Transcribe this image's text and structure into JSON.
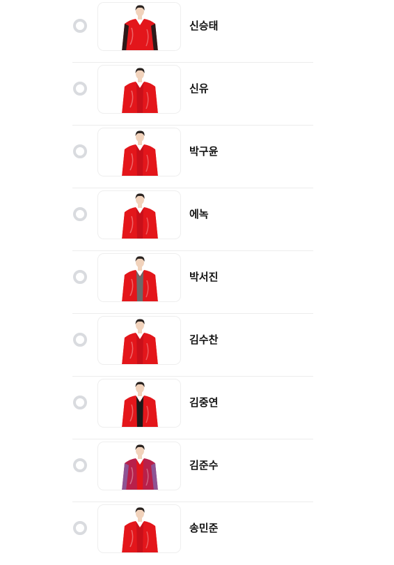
{
  "candidates": [
    {
      "name": "신승태",
      "outfit_color": "#e3161b",
      "accent": "#1a1a1a",
      "inner": "#e3161b"
    },
    {
      "name": "신유",
      "outfit_color": "#e3161b",
      "accent": "#e3161b",
      "inner": "#c8101a"
    },
    {
      "name": "박구윤",
      "outfit_color": "#e3161b",
      "accent": "#e3161b",
      "inner": "#c8101a"
    },
    {
      "name": "에녹",
      "outfit_color": "#e3161b",
      "accent": "#e3161b",
      "inner": "#c8101a"
    },
    {
      "name": "박서진",
      "outfit_color": "#e3161b",
      "accent": "#e3161b",
      "inner": "#6b6a6a"
    },
    {
      "name": "김수찬",
      "outfit_color": "#e3161b",
      "accent": "#e3161b",
      "inner": "#c8101a"
    },
    {
      "name": "김중연",
      "outfit_color": "#e3161b",
      "accent": "#e3161b",
      "inner": "#1a1a1a"
    },
    {
      "name": "김준수",
      "outfit_color": "#b8204a",
      "accent": "#8a5a9c",
      "inner": "#e3161b"
    },
    {
      "name": "송민준",
      "outfit_color": "#e3161b",
      "accent": "#e3161b",
      "inner": "#c8101a"
    }
  ],
  "colors": {
    "radio_border": "#d9dbdf",
    "divider": "#ececec",
    "skin": "#f1d2bb",
    "hair": "#2a2320"
  }
}
